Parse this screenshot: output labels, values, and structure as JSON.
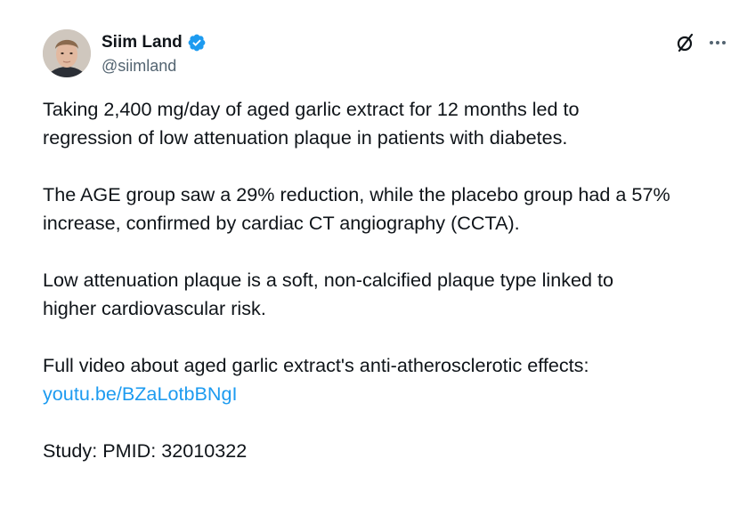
{
  "author": {
    "display_name": "Siim Land",
    "handle": "@siimland",
    "verified": true,
    "avatar_icon": "profile-photo"
  },
  "actions": {
    "grok_icon": "grok-slash-icon",
    "more_icon": "more-dots-icon"
  },
  "tweet": {
    "p1": {
      "line1": "Taking 2,400 mg/day of aged garlic extract for 12 months led to",
      "line2": "regression of low attenuation plaque in patients with diabetes."
    },
    "p2": {
      "line1": "The AGE group saw a 29% reduction, while the placebo group had a 57%",
      "line2": "increase, confirmed by cardiac CT angiography (CCTA)."
    },
    "p3": {
      "line1": "Low attenuation plaque is a soft, non-calcified plaque type linked to",
      "line2": "higher cardiovascular risk."
    },
    "p4": {
      "line1": "Full video about aged garlic extract's anti-atherosclerotic effects:",
      "link": "youtu.be/BZaLotbBNgI"
    },
    "p5": {
      "line1": "Study: PMID: 32010322"
    }
  },
  "colors": {
    "text": "#0f1419",
    "secondary": "#536471",
    "link": "#1d9bf0",
    "verified": "#1d9bf0"
  }
}
